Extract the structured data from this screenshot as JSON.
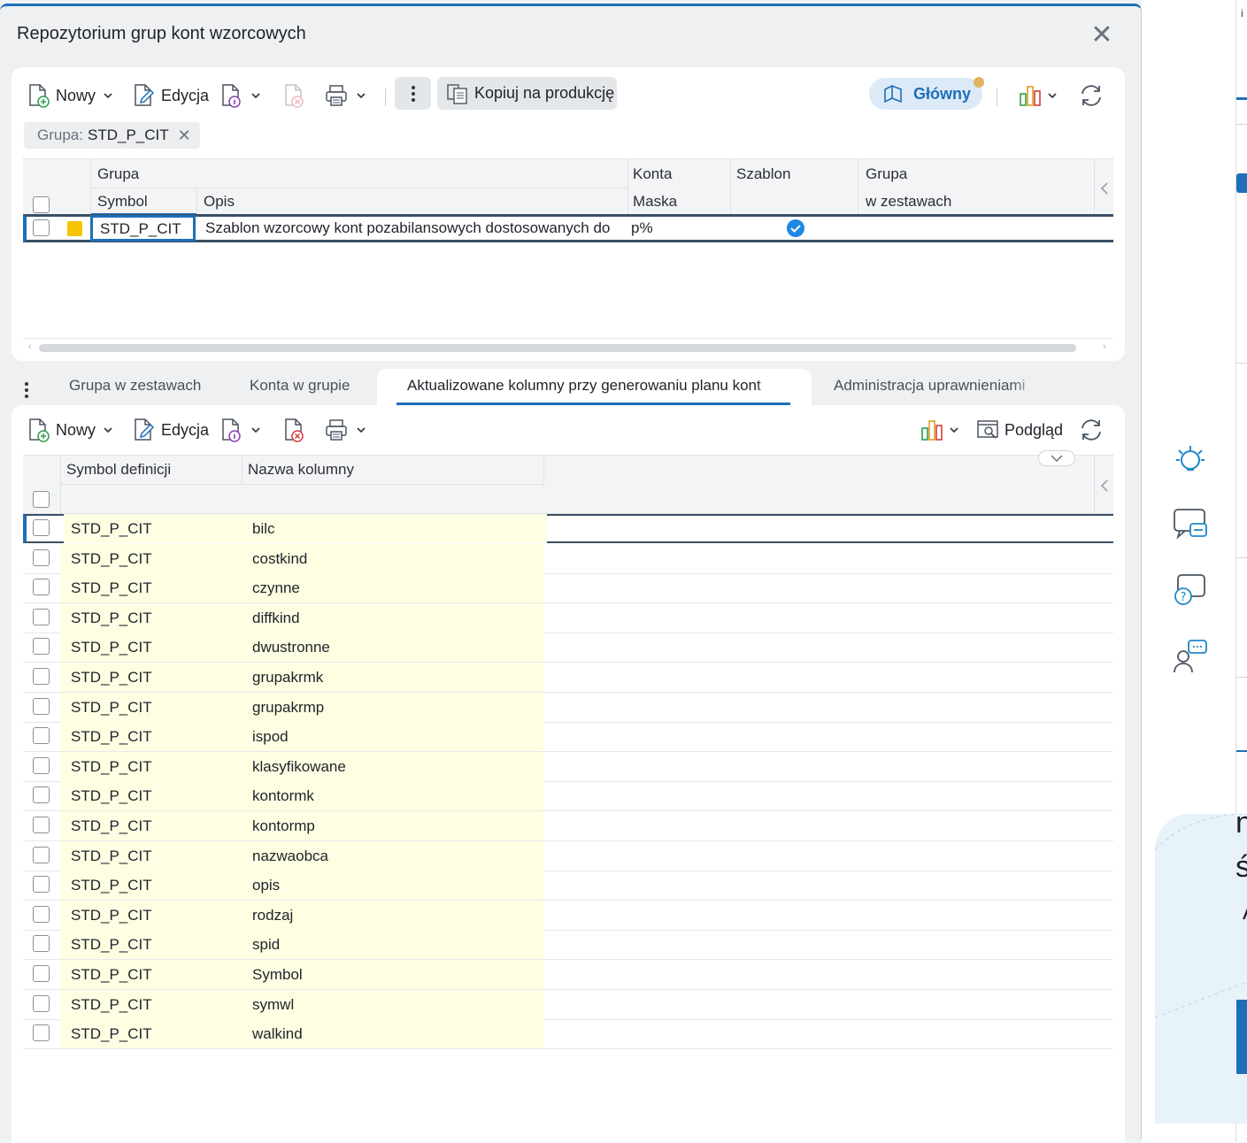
{
  "dialog": {
    "title": "Repozytorium grup kont wzorcowych",
    "close_symbol": "✕"
  },
  "toolbar_top": {
    "new_label": "Nowy",
    "edit_label": "Edycja",
    "copy_label": "Kopiuj na produkcję",
    "main_label": "Główny"
  },
  "filter": {
    "label": "Grupa:",
    "value": "STD_P_CIT",
    "remove_symbol": "✕"
  },
  "top_grid": {
    "header_group": "Grupa",
    "header_symbol": "Symbol",
    "header_opis": "Opis",
    "header_konta": "Konta",
    "header_maska": "Maska",
    "header_szablon": "Szablon",
    "header_grupa2": "Grupa",
    "header_w_zestawach": "w zestawach",
    "row": {
      "symbol": "STD_P_CIT",
      "opis": "Szablon wzorcowy kont pozabilansowych dostosowanych do",
      "maska": "p%",
      "szablon": true,
      "color": "#f5c400"
    }
  },
  "tabs": [
    {
      "label": "Grupa w zestawach",
      "active": false
    },
    {
      "label": "Konta w grupie",
      "active": false
    },
    {
      "label": "Aktualizowane kolumny przy generowaniu planu kont",
      "active": true
    },
    {
      "label": "Administracja uprawnieniami",
      "active": false
    }
  ],
  "toolbar_bottom": {
    "new_label": "Nowy",
    "edit_label": "Edycja",
    "preview_label": "Podgląd"
  },
  "bottom_grid": {
    "header_symbol": "Symbol definicji",
    "header_nazwa": "Nazwa kolumny",
    "rows": [
      {
        "symbol": "STD_P_CIT",
        "nazwa": "bilc"
      },
      {
        "symbol": "STD_P_CIT",
        "nazwa": "costkind"
      },
      {
        "symbol": "STD_P_CIT",
        "nazwa": "czynne"
      },
      {
        "symbol": "STD_P_CIT",
        "nazwa": "diffkind"
      },
      {
        "symbol": "STD_P_CIT",
        "nazwa": "dwustronne"
      },
      {
        "symbol": "STD_P_CIT",
        "nazwa": "grupakrmk"
      },
      {
        "symbol": "STD_P_CIT",
        "nazwa": "grupakrmp"
      },
      {
        "symbol": "STD_P_CIT",
        "nazwa": "ispod"
      },
      {
        "symbol": "STD_P_CIT",
        "nazwa": "klasyfikowane"
      },
      {
        "symbol": "STD_P_CIT",
        "nazwa": "kontormk"
      },
      {
        "symbol": "STD_P_CIT",
        "nazwa": "kontormp"
      },
      {
        "symbol": "STD_P_CIT",
        "nazwa": "nazwaobca"
      },
      {
        "symbol": "STD_P_CIT",
        "nazwa": "opis"
      },
      {
        "symbol": "STD_P_CIT",
        "nazwa": "rodzaj"
      },
      {
        "symbol": "STD_P_CIT",
        "nazwa": "spid"
      },
      {
        "symbol": "STD_P_CIT",
        "nazwa": "Symbol"
      },
      {
        "symbol": "STD_P_CIT",
        "nazwa": "symwl"
      },
      {
        "symbol": "STD_P_CIT",
        "nazwa": "walkind"
      }
    ]
  },
  "background": {
    "tiny_text": "i",
    "letters": [
      "ni",
      "św",
      "A"
    ]
  },
  "colors": {
    "accent": "#1e6fb8",
    "selected_cell_bg": "#fefee3",
    "badge": "#e0b45a"
  }
}
